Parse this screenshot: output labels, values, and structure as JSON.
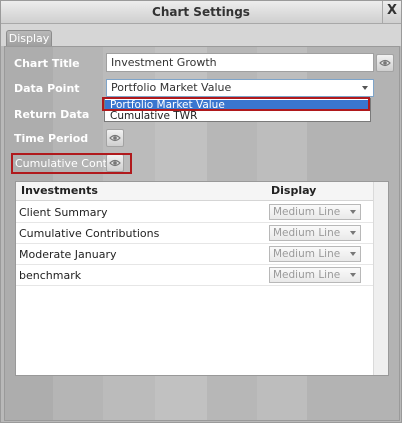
{
  "window": {
    "title": "Chart Settings",
    "close_label": "X"
  },
  "tabs": [
    {
      "label": "Display"
    }
  ],
  "form": {
    "chart_title_label": "Chart Title",
    "chart_title_value": "Investment Growth",
    "data_point_label": "Data Point",
    "data_point_value": "Portfolio Market Value",
    "data_point_options": [
      "Portfolio Market Value",
      "Cumulative TWR"
    ],
    "return_data_label": "Return Data",
    "time_period_label": "Time Period",
    "cumulative_label": "Cumulative Contributions"
  },
  "grid": {
    "columns": [
      "Investments",
      "Display"
    ],
    "rows": [
      {
        "name": "Client Summary",
        "display": "Medium Line"
      },
      {
        "name": "Cumulative Contributions",
        "display": "Medium Line"
      },
      {
        "name": "Moderate January",
        "display": "Medium Line"
      },
      {
        "name": "benchmark",
        "display": "Medium Line"
      }
    ]
  },
  "colors": {
    "highlight": "#b0191c",
    "selection": "#3a76cf"
  },
  "icons": [
    "eye-icon",
    "dropdown-arrow-icon",
    "close-icon"
  ]
}
